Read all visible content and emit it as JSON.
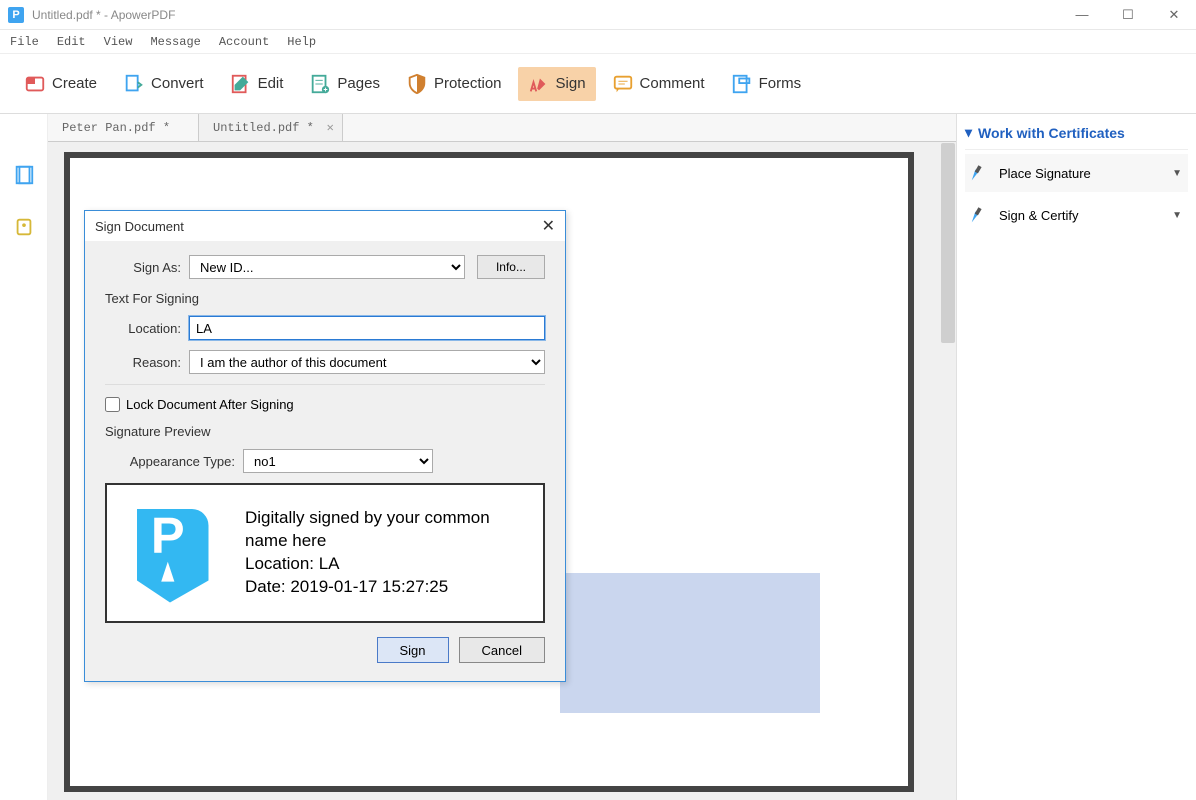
{
  "window": {
    "title": "Untitled.pdf * - ApowerPDF"
  },
  "menubar": [
    "File",
    "Edit",
    "View",
    "Message",
    "Account",
    "Help"
  ],
  "toolbar": [
    {
      "id": "create",
      "label": "Create"
    },
    {
      "id": "convert",
      "label": "Convert"
    },
    {
      "id": "edit",
      "label": "Edit"
    },
    {
      "id": "pages",
      "label": "Pages"
    },
    {
      "id": "protection",
      "label": "Protection"
    },
    {
      "id": "sign",
      "label": "Sign",
      "active": true
    },
    {
      "id": "comment",
      "label": "Comment"
    },
    {
      "id": "forms",
      "label": "Forms"
    }
  ],
  "tabs": [
    {
      "label": "Peter Pan.pdf *",
      "active": false
    },
    {
      "label": "Untitled.pdf *",
      "active": true
    }
  ],
  "rightpanel": {
    "title": "Work with Certificates",
    "items": [
      {
        "label": "Place Signature"
      },
      {
        "label": "Sign & Certify"
      }
    ]
  },
  "dialog": {
    "title": "Sign Document",
    "sign_as_label": "Sign As:",
    "sign_as_value": "New ID...",
    "info_btn": "Info...",
    "section_text": "Text For Signing",
    "location_label": "Location:",
    "location_value": "LA",
    "reason_label": "Reason:",
    "reason_value": "I am the author of this document",
    "lock_label": "Lock Document After Signing",
    "preview_section": "Signature Preview",
    "appearance_label": "Appearance Type:",
    "appearance_value": "no1",
    "preview_line1": "Digitally signed by your common name here",
    "preview_line2": "Location: LA",
    "preview_line3": "Date: 2019-01-17 15:27:25",
    "sign_btn": "Sign",
    "cancel_btn": "Cancel"
  }
}
